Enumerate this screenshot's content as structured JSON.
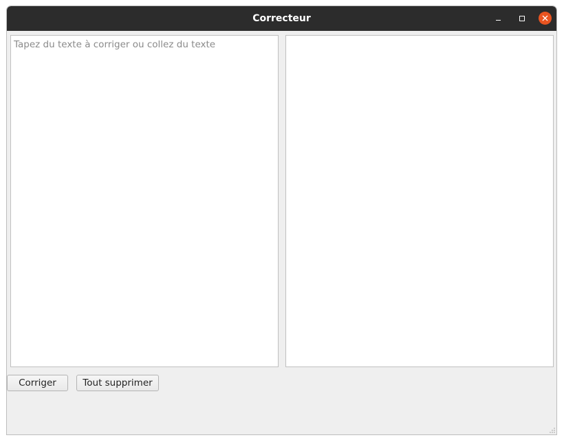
{
  "window": {
    "title": "Correcteur",
    "controls": [
      "minimize",
      "maximize",
      "close"
    ]
  },
  "input_pane": {
    "value": "",
    "placeholder": "Tapez du texte à corriger ou collez du texte"
  },
  "output_pane": {
    "value": ""
  },
  "buttons": {
    "correct_label": "Corriger",
    "clear_label": "Tout supprimer"
  },
  "colors": {
    "titlebar": "#2c2c2c",
    "close_button": "#e95420",
    "window_bg": "#efefef"
  }
}
